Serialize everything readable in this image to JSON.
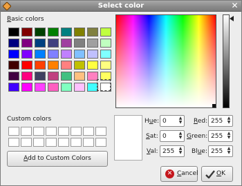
{
  "window": {
    "title": "Select color",
    "icon": "app-diamond-icon",
    "close_icon": "close-x-icon"
  },
  "basic_colors": {
    "label_mnemonic": "B",
    "label_rest": "asic colors",
    "rows": [
      [
        "#000000",
        "#800000",
        "#004000",
        "#008000",
        "#008080",
        "#808000",
        "#808040",
        "#c0ff40"
      ],
      [
        "#000080",
        "#800080",
        "#004080",
        "#404080",
        "#a040a0",
        "#808080",
        "#a0a0a0",
        "#c0ffc0"
      ],
      [
        "#0000ff",
        "#8000ff",
        "#0080ff",
        "#8080ff",
        "#c080ff",
        "#80c0ff",
        "#c0c0ff",
        "#80ffff"
      ],
      [
        "#400000",
        "#ff0000",
        "#ff4000",
        "#ff8000",
        "#ff8080",
        "#c0c000",
        "#ffff40",
        "#ffff80"
      ],
      [
        "#400040",
        "#ff0080",
        "#404060",
        "#c04080",
        "#40c080",
        "#ffc080",
        "#ff80c0",
        "#ffff60"
      ],
      [
        "#4000ff",
        "#ff00ff",
        "#ff40ff",
        "#ff60c0",
        "#80ffc0",
        "#ffc0ff",
        "#40ffff",
        "#ffffff"
      ]
    ]
  },
  "custom_colors": {
    "label": "Custom colors",
    "count": 16
  },
  "add_button": {
    "label_mnemonic": "A",
    "label_rest": "dd to Custom Colors"
  },
  "hsv": {
    "hue": {
      "label_mnemonic": "u",
      "label_pre": "H",
      "label_post": "e:",
      "value": "0"
    },
    "sat": {
      "label_mnemonic": "S",
      "label_pre": "",
      "label_post": "at:",
      "value": "0"
    },
    "val": {
      "label_mnemonic": "V",
      "label_pre": "",
      "label_post": "al:",
      "value": "255"
    }
  },
  "rgb": {
    "red": {
      "label_mnemonic": "R",
      "label_pre": "",
      "label_post": "ed:",
      "value": "255"
    },
    "green": {
      "label_mnemonic": "G",
      "label_pre": "",
      "label_post": "reen:",
      "value": "255"
    },
    "blue": {
      "label_mnemonic": "u",
      "label_pre": "Bl",
      "label_post": "e:",
      "value": "255"
    }
  },
  "buttons": {
    "cancel": {
      "label_mnemonic": "C",
      "label_rest": "ancel",
      "icon": "cancel-icon"
    },
    "ok": {
      "label_mnemonic": "O",
      "label_rest": "K",
      "icon": "ok-checkmark-icon"
    }
  },
  "selected_color": "#ffffff"
}
